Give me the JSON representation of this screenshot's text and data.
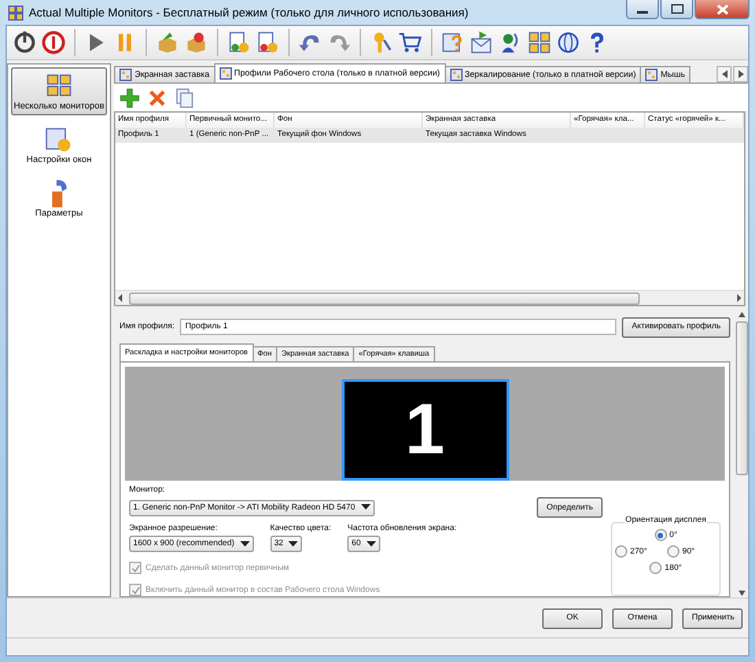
{
  "window": {
    "title": "Actual Multiple Monitors - Бесплатный режим (только для личного использования)"
  },
  "sidebar": {
    "items": [
      {
        "label": "Несколько мониторов",
        "selected": true
      },
      {
        "label": "Настройки окон",
        "selected": false
      },
      {
        "label": "Параметры",
        "selected": false
      }
    ]
  },
  "tabs": [
    {
      "label": "Экранная заставка",
      "selected": false
    },
    {
      "label": "Профили Рабочего стола (только в платной версии)",
      "selected": true
    },
    {
      "label": "Зеркалирование (только в платной версии)",
      "selected": false
    },
    {
      "label": "Мышь",
      "selected": false
    }
  ],
  "table": {
    "columns": [
      "Имя профиля",
      "Первичный монито...",
      "Фон",
      "Экранная заставка",
      "«Горячая» кла...",
      "Статус «горячей» к..."
    ],
    "rows": [
      {
        "cells": [
          "Профиль 1",
          "1 (Generic non-PnP ...",
          "Текущий фон Windows",
          "Текущая заставка Windows"
        ],
        "selected": true
      }
    ]
  },
  "profile": {
    "label": "Имя профиля:",
    "value": "Профиль 1",
    "activate_button": "Активировать профиль"
  },
  "inner_tabs": [
    {
      "label": "Раскладка и настройки мониторов",
      "selected": true
    },
    {
      "label": "Фон",
      "selected": false
    },
    {
      "label": "Экранная заставка",
      "selected": false
    },
    {
      "label": "«Горячая» клавиша",
      "selected": false
    }
  ],
  "monitors": [
    {
      "number": "1",
      "selected": true
    }
  ],
  "monitor_select": {
    "label": "Монитор:",
    "value": "1. Generic non-PnP Monitor -> ATI Mobility Radeon HD 5470"
  },
  "identify_button": "Определить",
  "settings": [
    {
      "label": "Экранное разрешение:",
      "value": "1600 x 900 (recommended)"
    },
    {
      "label": "Качество цвета:",
      "value": "32"
    },
    {
      "label": "Частота обновления экрана:",
      "value": "60"
    }
  ],
  "checkboxes": [
    {
      "label": "Сделать данный монитор первичным",
      "checked": true,
      "disabled": true
    },
    {
      "label": "Включить данный монитор в состав Рабочего стола Windows",
      "checked": true,
      "disabled": true
    }
  ],
  "orientation": {
    "title": "Ориентация дисплея",
    "options": [
      {
        "label": "0°",
        "selected": true
      },
      {
        "label": "270°",
        "selected": false
      },
      {
        "label": "90°",
        "selected": false
      },
      {
        "label": "180°",
        "selected": false
      }
    ]
  },
  "buttons": [
    "OK",
    "Отмена",
    "Применить"
  ]
}
